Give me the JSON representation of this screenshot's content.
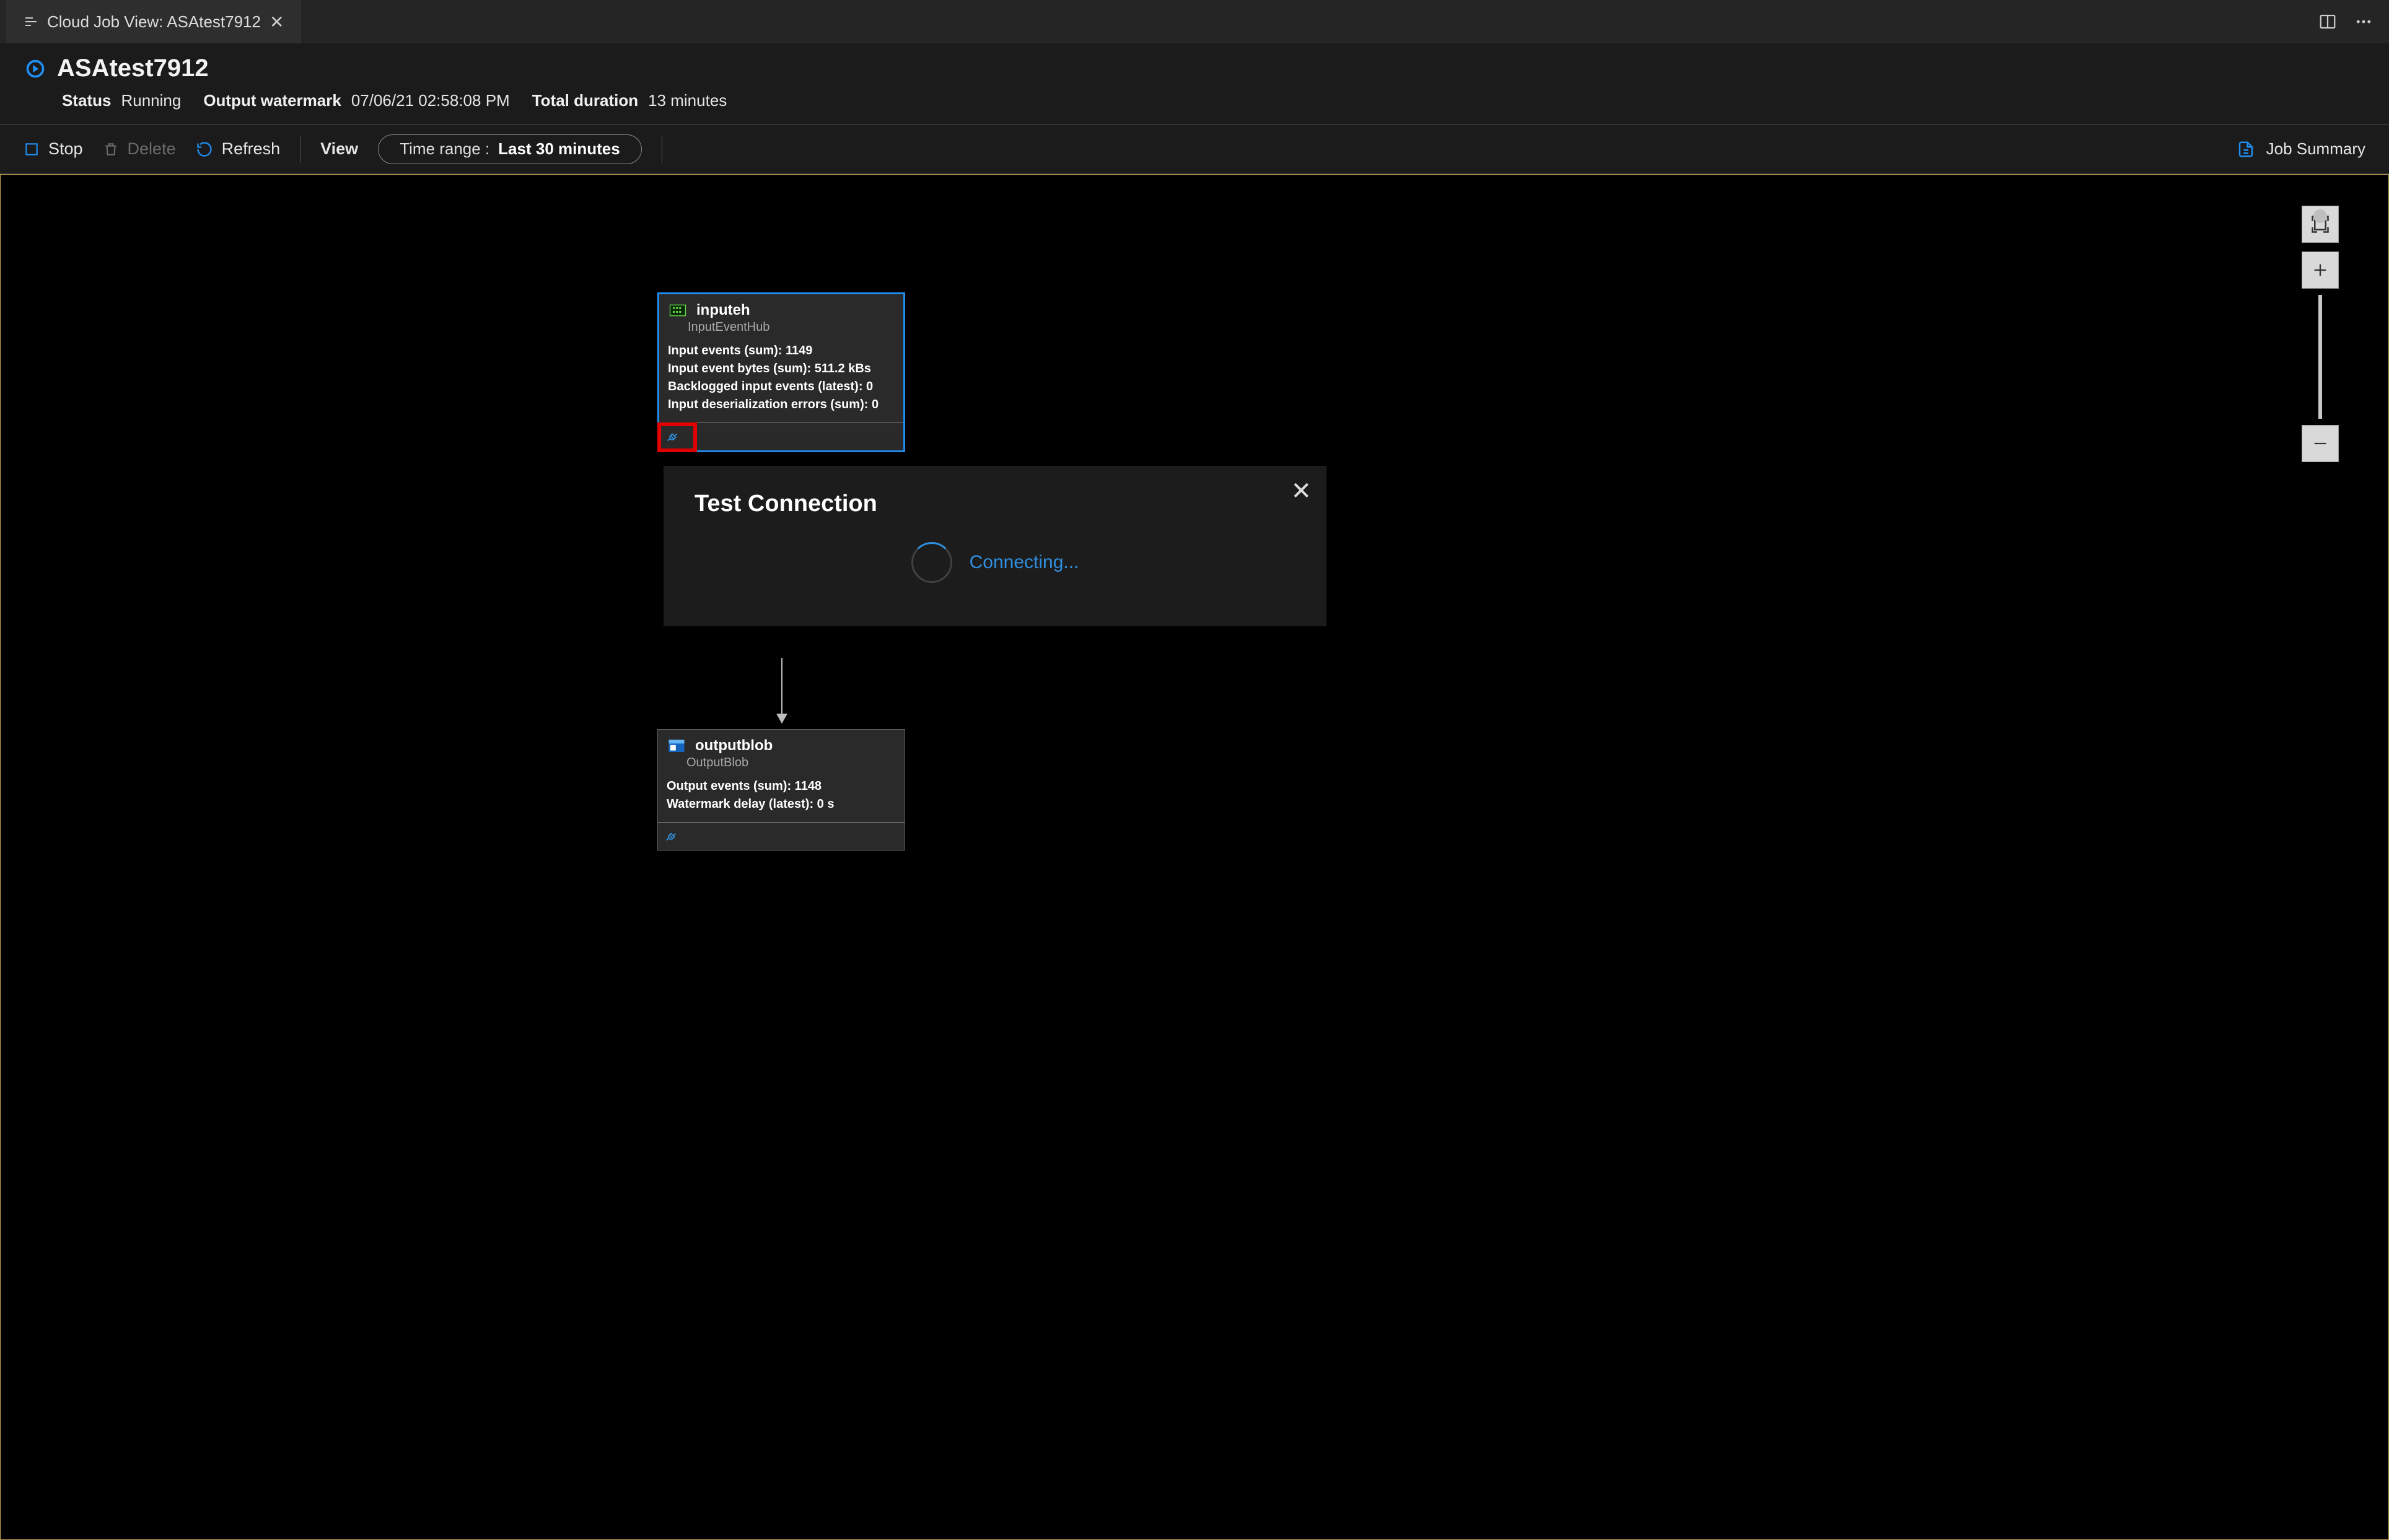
{
  "tab": {
    "title": "Cloud Job View: ASAtest7912"
  },
  "header": {
    "job_name": "ASAtest7912",
    "status_label": "Status",
    "status_value": "Running",
    "watermark_label": "Output watermark",
    "watermark_value": "07/06/21 02:58:08 PM",
    "duration_label": "Total duration",
    "duration_value": "13 minutes"
  },
  "toolbar": {
    "stop": "Stop",
    "delete": "Delete",
    "refresh": "Refresh",
    "view": "View",
    "time_prefix": "Time range :",
    "time_value": "Last 30 minutes",
    "job_summary": "Job Summary"
  },
  "diagram": {
    "input_node": {
      "title": "inputeh",
      "subtitle": "InputEventHub",
      "metrics": [
        "Input events (sum): 1149",
        "Input event bytes (sum): 511.2 kBs",
        "Backlogged input events (latest): 0",
        "Input deserialization errors (sum): 0"
      ]
    },
    "output_node": {
      "title": "outputblob",
      "subtitle": "OutputBlob",
      "metrics": [
        "Output events (sum): 1148",
        "Watermark delay (latest): 0 s"
      ]
    }
  },
  "popup": {
    "title": "Test Connection",
    "status": "Connecting..."
  }
}
